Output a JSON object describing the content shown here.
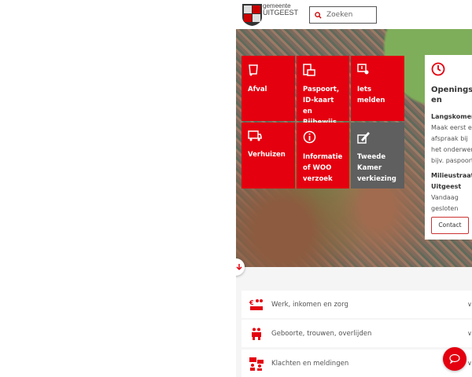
{
  "header": {
    "logo_line1": "gemeente",
    "logo_line2": "UITGEEST",
    "search_placeholder": "Zoeken"
  },
  "tiles": [
    {
      "label": "Afval",
      "icon": "waste-bin-icon"
    },
    {
      "label": "Paspoort, ID-kaart en Rijbewijs",
      "icon": "id-card-icon"
    },
    {
      "label": "Iets melden",
      "icon": "report-location-icon"
    },
    {
      "label": "Verhuizen",
      "icon": "moving-truck-icon"
    },
    {
      "label": "Informatie of WOO verzoek",
      "icon": "info-icon"
    },
    {
      "label": "Tweede Kamer verkiezing",
      "icon": "vote-icon"
    }
  ],
  "opening": {
    "title": "Openingstijden",
    "l1": "Langskomen?",
    "l2": "Maak eerst een",
    "l3": "afspraak bij",
    "l4": "het onderwerp,",
    "l5": "bijv. paspoort",
    "l6": "Milieustraat",
    "l7": "Uitgeest",
    "l8": "Vandaag",
    "l9": "gesloten",
    "contact": "Contact"
  },
  "accordion": [
    {
      "label": "Werk, inkomen en zorg"
    },
    {
      "label": "Geboorte, trouwen, overlijden"
    },
    {
      "label": "Klachten en meldingen"
    }
  ],
  "colors": {
    "brand": "#e4000f",
    "gray_tile": "#5f5f5f"
  }
}
